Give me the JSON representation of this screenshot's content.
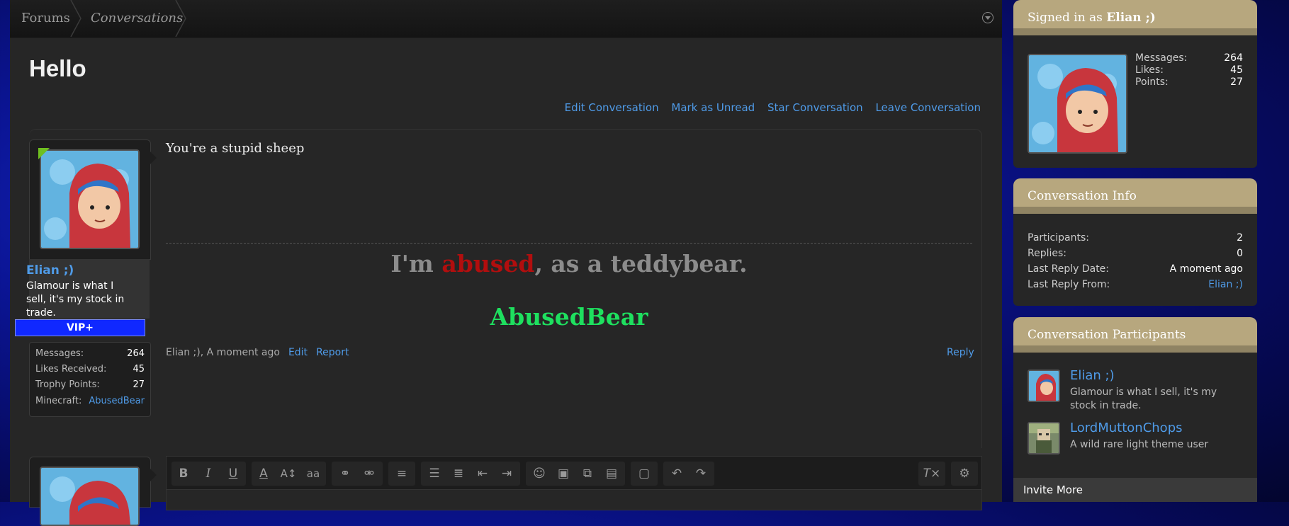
{
  "breadcrumb": {
    "items": [
      "Forums",
      "Conversations"
    ]
  },
  "page": {
    "title": "Hello"
  },
  "conversation_actions": [
    "Edit Conversation",
    "Mark as Unread",
    "Star Conversation",
    "Leave Conversation"
  ],
  "message": {
    "author": "Elian ;)",
    "author_title": "Glamour is what I sell, it's my stock in trade.",
    "badge": "VIP+",
    "stats": [
      {
        "label": "Messages:",
        "value": "264"
      },
      {
        "label": "Likes Received:",
        "value": "45"
      },
      {
        "label": "Trophy Points:",
        "value": "27"
      },
      {
        "label": "Minecraft:",
        "value": "AbusedBear"
      }
    ],
    "body": "You're a stupid sheep",
    "signature": {
      "line1_pre": "I'm ",
      "line1_red": "abused",
      "line1_post": ", as a teddybear.",
      "line2": "AbusedBear"
    },
    "meta_author_time": "Elian ;), A moment ago",
    "edit_label": "Edit",
    "report_label": "Report",
    "reply_label": "Reply"
  },
  "editor": {
    "toolbar": [
      "bold-icon",
      "italic-icon",
      "underline-icon",
      "text-color-icon",
      "font-size-icon",
      "font-family-icon",
      "link-icon",
      "unlink-icon",
      "align-icon",
      "bullet-list-icon",
      "numbered-list-icon",
      "outdent-icon",
      "indent-icon",
      "smilie-icon",
      "image-icon",
      "media-icon",
      "quote-icon",
      "save-draft-icon",
      "undo-icon",
      "redo-icon",
      "remove-format-icon",
      "toggle-bbcode-icon"
    ]
  },
  "sidebar": {
    "visitor": {
      "signed_in_prefix": "Signed in as",
      "name": "Elian ;)",
      "stats": [
        {
          "label": "Messages:",
          "value": "264"
        },
        {
          "label": "Likes:",
          "value": "45"
        },
        {
          "label": "Points:",
          "value": "27"
        }
      ]
    },
    "conversation_info": {
      "title": "Conversation Info",
      "rows": [
        {
          "label": "Participants:",
          "value": "2"
        },
        {
          "label": "Replies:",
          "value": "0"
        },
        {
          "label": "Last Reply Date:",
          "value": "A moment ago"
        },
        {
          "label": "Last Reply From:",
          "value": "Elian ;)"
        }
      ]
    },
    "participants": {
      "title": "Conversation Participants",
      "items": [
        {
          "name": "Elian ;)",
          "title": "Glamour is what I sell, it's my stock in trade."
        },
        {
          "name": "LordMuttonChops",
          "title": "A wild rare light theme user"
        }
      ],
      "invite_label": "Invite More"
    }
  },
  "colors": {
    "link": "#4f9be8",
    "vip": "#1028ff",
    "sidebar_head": "#b7a77e",
    "sig_red": "#b20e0e",
    "sig_green": "#1ee05f"
  }
}
